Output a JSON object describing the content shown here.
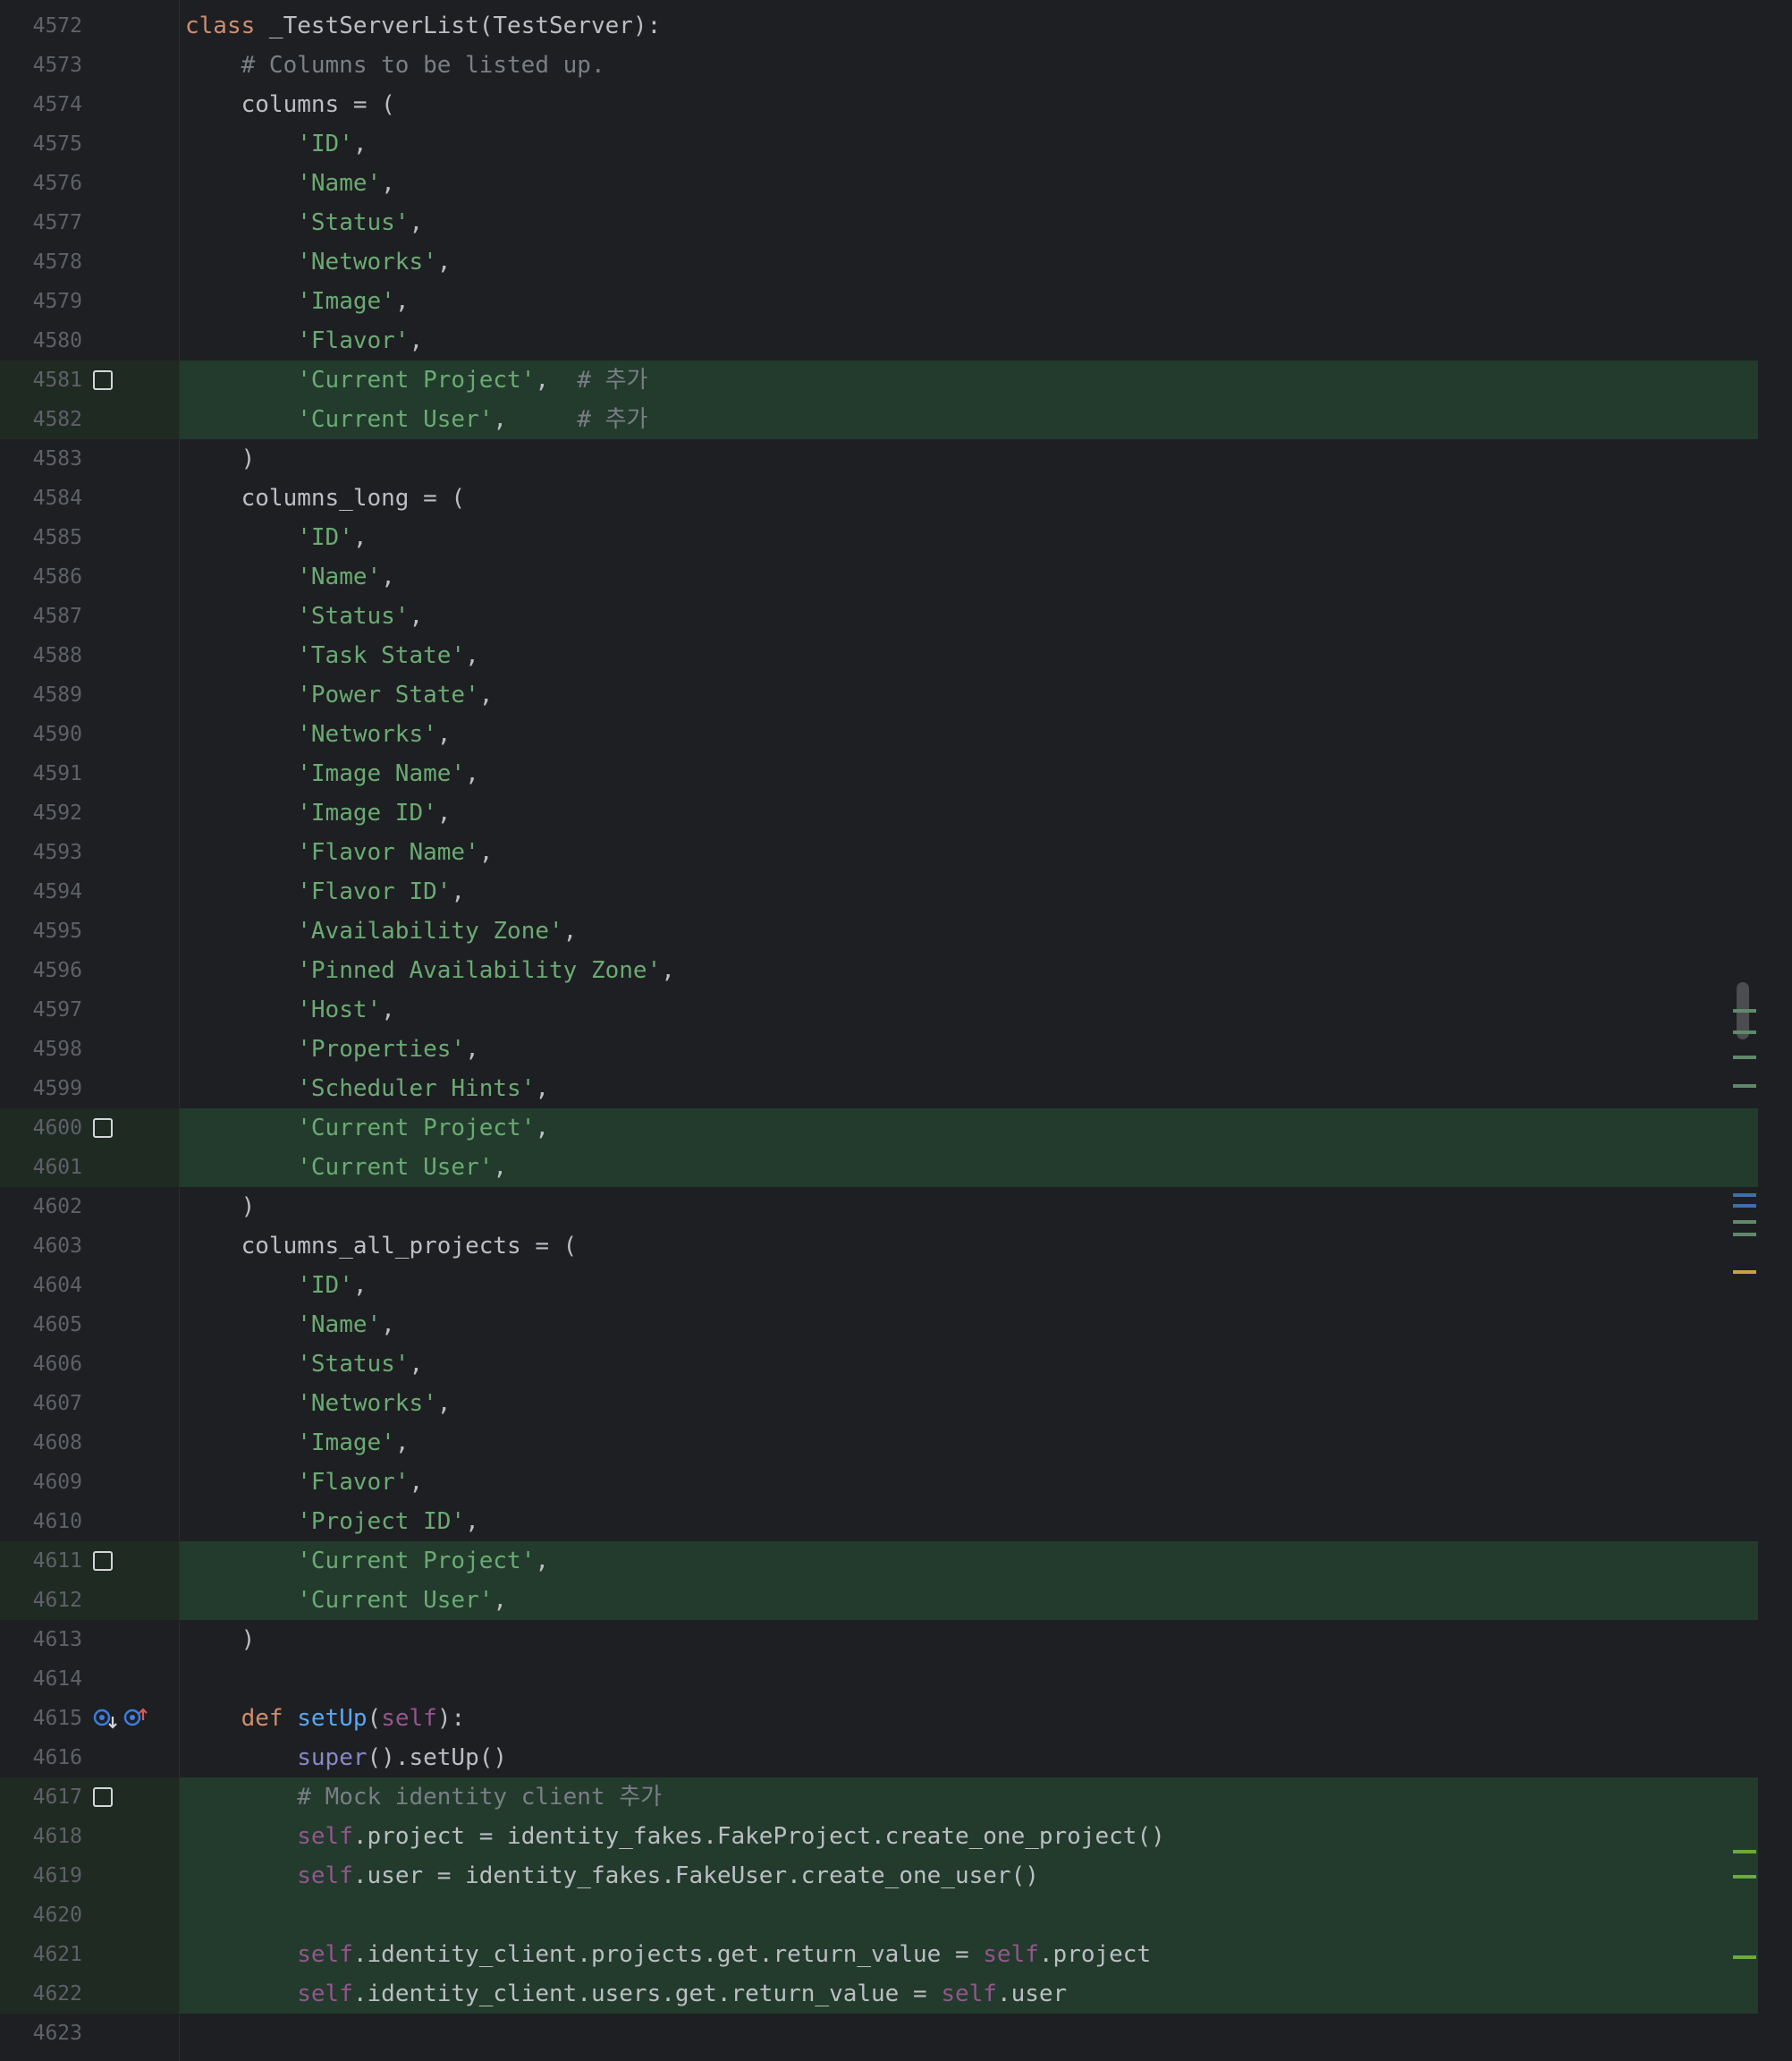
{
  "editor": {
    "language": "python",
    "colors": {
      "background": "#1e1f22",
      "added_line_bg": "#223b2c",
      "line_number": "#5e6168",
      "keyword": "#cf8e6d",
      "string": "#6aab73",
      "comment": "#7a7e85",
      "function": "#56a8f5",
      "self": "#94558d",
      "builtin": "#8888c6",
      "text": "#bcbec4"
    },
    "gutter_icons": [
      "implemented-by-down-icon",
      "overrides-up-icon"
    ],
    "lines": [
      {
        "n": "4572",
        "added": false,
        "checkbox": false,
        "tokens": [
          {
            "t": "kw",
            "v": "class"
          },
          {
            "t": "id",
            "v": " _TestServerList(TestServer):"
          }
        ]
      },
      {
        "n": "4573",
        "added": false,
        "checkbox": false,
        "tokens": [
          {
            "t": "cm",
            "v": "    # Columns to be listed up."
          }
        ]
      },
      {
        "n": "4574",
        "added": false,
        "checkbox": false,
        "tokens": [
          {
            "t": "id",
            "v": "    columns = ("
          }
        ]
      },
      {
        "n": "4575",
        "added": false,
        "checkbox": false,
        "tokens": [
          {
            "t": "id",
            "v": "        "
          },
          {
            "t": "str",
            "v": "'ID'"
          },
          {
            "t": "id",
            "v": ","
          }
        ]
      },
      {
        "n": "4576",
        "added": false,
        "checkbox": false,
        "tokens": [
          {
            "t": "id",
            "v": "        "
          },
          {
            "t": "str",
            "v": "'Name'"
          },
          {
            "t": "id",
            "v": ","
          }
        ]
      },
      {
        "n": "4577",
        "added": false,
        "checkbox": false,
        "tokens": [
          {
            "t": "id",
            "v": "        "
          },
          {
            "t": "str",
            "v": "'Status'"
          },
          {
            "t": "id",
            "v": ","
          }
        ]
      },
      {
        "n": "4578",
        "added": false,
        "checkbox": false,
        "tokens": [
          {
            "t": "id",
            "v": "        "
          },
          {
            "t": "str",
            "v": "'Networks'"
          },
          {
            "t": "id",
            "v": ","
          }
        ]
      },
      {
        "n": "4579",
        "added": false,
        "checkbox": false,
        "tokens": [
          {
            "t": "id",
            "v": "        "
          },
          {
            "t": "str",
            "v": "'Image'"
          },
          {
            "t": "id",
            "v": ","
          }
        ]
      },
      {
        "n": "4580",
        "added": false,
        "checkbox": false,
        "tokens": [
          {
            "t": "id",
            "v": "        "
          },
          {
            "t": "str",
            "v": "'Flavor'"
          },
          {
            "t": "id",
            "v": ","
          }
        ]
      },
      {
        "n": "4581",
        "added": true,
        "checkbox": true,
        "tokens": [
          {
            "t": "id",
            "v": "        "
          },
          {
            "t": "str",
            "v": "'Current Project'"
          },
          {
            "t": "id",
            "v": ",  "
          },
          {
            "t": "cm",
            "v": "# 추가"
          }
        ]
      },
      {
        "n": "4582",
        "added": true,
        "checkbox": false,
        "tokens": [
          {
            "t": "id",
            "v": "        "
          },
          {
            "t": "str",
            "v": "'Current User'"
          },
          {
            "t": "id",
            "v": ",     "
          },
          {
            "t": "cm",
            "v": "# 추가"
          }
        ]
      },
      {
        "n": "4583",
        "added": false,
        "checkbox": false,
        "tokens": [
          {
            "t": "id",
            "v": "    )"
          }
        ]
      },
      {
        "n": "4584",
        "added": false,
        "checkbox": false,
        "tokens": [
          {
            "t": "id",
            "v": "    columns_long = ("
          }
        ]
      },
      {
        "n": "4585",
        "added": false,
        "checkbox": false,
        "tokens": [
          {
            "t": "id",
            "v": "        "
          },
          {
            "t": "str",
            "v": "'ID'"
          },
          {
            "t": "id",
            "v": ","
          }
        ]
      },
      {
        "n": "4586",
        "added": false,
        "checkbox": false,
        "tokens": [
          {
            "t": "id",
            "v": "        "
          },
          {
            "t": "str",
            "v": "'Name'"
          },
          {
            "t": "id",
            "v": ","
          }
        ]
      },
      {
        "n": "4587",
        "added": false,
        "checkbox": false,
        "tokens": [
          {
            "t": "id",
            "v": "        "
          },
          {
            "t": "str",
            "v": "'Status'"
          },
          {
            "t": "id",
            "v": ","
          }
        ]
      },
      {
        "n": "4588",
        "added": false,
        "checkbox": false,
        "tokens": [
          {
            "t": "id",
            "v": "        "
          },
          {
            "t": "str",
            "v": "'Task State'"
          },
          {
            "t": "id",
            "v": ","
          }
        ]
      },
      {
        "n": "4589",
        "added": false,
        "checkbox": false,
        "tokens": [
          {
            "t": "id",
            "v": "        "
          },
          {
            "t": "str",
            "v": "'Power State'"
          },
          {
            "t": "id",
            "v": ","
          }
        ]
      },
      {
        "n": "4590",
        "added": false,
        "checkbox": false,
        "tokens": [
          {
            "t": "id",
            "v": "        "
          },
          {
            "t": "str",
            "v": "'Networks'"
          },
          {
            "t": "id",
            "v": ","
          }
        ]
      },
      {
        "n": "4591",
        "added": false,
        "checkbox": false,
        "tokens": [
          {
            "t": "id",
            "v": "        "
          },
          {
            "t": "str",
            "v": "'Image Name'"
          },
          {
            "t": "id",
            "v": ","
          }
        ]
      },
      {
        "n": "4592",
        "added": false,
        "checkbox": false,
        "tokens": [
          {
            "t": "id",
            "v": "        "
          },
          {
            "t": "str",
            "v": "'Image ID'"
          },
          {
            "t": "id",
            "v": ","
          }
        ]
      },
      {
        "n": "4593",
        "added": false,
        "checkbox": false,
        "tokens": [
          {
            "t": "id",
            "v": "        "
          },
          {
            "t": "str",
            "v": "'Flavor Name'"
          },
          {
            "t": "id",
            "v": ","
          }
        ]
      },
      {
        "n": "4594",
        "added": false,
        "checkbox": false,
        "tokens": [
          {
            "t": "id",
            "v": "        "
          },
          {
            "t": "str",
            "v": "'Flavor ID'"
          },
          {
            "t": "id",
            "v": ","
          }
        ]
      },
      {
        "n": "4595",
        "added": false,
        "checkbox": false,
        "tokens": [
          {
            "t": "id",
            "v": "        "
          },
          {
            "t": "str",
            "v": "'Availability Zone'"
          },
          {
            "t": "id",
            "v": ","
          }
        ]
      },
      {
        "n": "4596",
        "added": false,
        "checkbox": false,
        "tokens": [
          {
            "t": "id",
            "v": "        "
          },
          {
            "t": "str",
            "v": "'Pinned Availability Zone'"
          },
          {
            "t": "id",
            "v": ","
          }
        ]
      },
      {
        "n": "4597",
        "added": false,
        "checkbox": false,
        "tokens": [
          {
            "t": "id",
            "v": "        "
          },
          {
            "t": "str",
            "v": "'Host'"
          },
          {
            "t": "id",
            "v": ","
          }
        ]
      },
      {
        "n": "4598",
        "added": false,
        "checkbox": false,
        "tokens": [
          {
            "t": "id",
            "v": "        "
          },
          {
            "t": "str",
            "v": "'Properties'"
          },
          {
            "t": "id",
            "v": ","
          }
        ]
      },
      {
        "n": "4599",
        "added": false,
        "checkbox": false,
        "tokens": [
          {
            "t": "id",
            "v": "        "
          },
          {
            "t": "str",
            "v": "'Scheduler Hints'"
          },
          {
            "t": "id",
            "v": ","
          }
        ]
      },
      {
        "n": "4600",
        "added": true,
        "checkbox": true,
        "tokens": [
          {
            "t": "id",
            "v": "        "
          },
          {
            "t": "str",
            "v": "'Current Project'"
          },
          {
            "t": "id",
            "v": ","
          }
        ]
      },
      {
        "n": "4601",
        "added": true,
        "checkbox": false,
        "tokens": [
          {
            "t": "id",
            "v": "        "
          },
          {
            "t": "str",
            "v": "'Current User'"
          },
          {
            "t": "id",
            "v": ","
          }
        ]
      },
      {
        "n": "4602",
        "added": false,
        "checkbox": false,
        "tokens": [
          {
            "t": "id",
            "v": "    )"
          }
        ]
      },
      {
        "n": "4603",
        "added": false,
        "checkbox": false,
        "tokens": [
          {
            "t": "id",
            "v": "    columns_all_projects = ("
          }
        ]
      },
      {
        "n": "4604",
        "added": false,
        "checkbox": false,
        "tokens": [
          {
            "t": "id",
            "v": "        "
          },
          {
            "t": "str",
            "v": "'ID'"
          },
          {
            "t": "id",
            "v": ","
          }
        ]
      },
      {
        "n": "4605",
        "added": false,
        "checkbox": false,
        "tokens": [
          {
            "t": "id",
            "v": "        "
          },
          {
            "t": "str",
            "v": "'Name'"
          },
          {
            "t": "id",
            "v": ","
          }
        ]
      },
      {
        "n": "4606",
        "added": false,
        "checkbox": false,
        "tokens": [
          {
            "t": "id",
            "v": "        "
          },
          {
            "t": "str",
            "v": "'Status'"
          },
          {
            "t": "id",
            "v": ","
          }
        ]
      },
      {
        "n": "4607",
        "added": false,
        "checkbox": false,
        "tokens": [
          {
            "t": "id",
            "v": "        "
          },
          {
            "t": "str",
            "v": "'Networks'"
          },
          {
            "t": "id",
            "v": ","
          }
        ]
      },
      {
        "n": "4608",
        "added": false,
        "checkbox": false,
        "tokens": [
          {
            "t": "id",
            "v": "        "
          },
          {
            "t": "str",
            "v": "'Image'"
          },
          {
            "t": "id",
            "v": ","
          }
        ]
      },
      {
        "n": "4609",
        "added": false,
        "checkbox": false,
        "tokens": [
          {
            "t": "id",
            "v": "        "
          },
          {
            "t": "str",
            "v": "'Flavor'"
          },
          {
            "t": "id",
            "v": ","
          }
        ]
      },
      {
        "n": "4610",
        "added": false,
        "checkbox": false,
        "tokens": [
          {
            "t": "id",
            "v": "        "
          },
          {
            "t": "str",
            "v": "'Project ID'"
          },
          {
            "t": "id",
            "v": ","
          }
        ]
      },
      {
        "n": "4611",
        "added": true,
        "checkbox": true,
        "tokens": [
          {
            "t": "id",
            "v": "        "
          },
          {
            "t": "str",
            "v": "'Current Project'"
          },
          {
            "t": "id",
            "v": ","
          }
        ]
      },
      {
        "n": "4612",
        "added": true,
        "checkbox": false,
        "tokens": [
          {
            "t": "id",
            "v": "        "
          },
          {
            "t": "str",
            "v": "'Current User'"
          },
          {
            "t": "id",
            "v": ","
          }
        ]
      },
      {
        "n": "4613",
        "added": false,
        "checkbox": false,
        "tokens": [
          {
            "t": "id",
            "v": "    )"
          }
        ]
      },
      {
        "n": "4614",
        "added": false,
        "checkbox": false,
        "tokens": []
      },
      {
        "n": "4615",
        "added": false,
        "checkbox": false,
        "icons": true,
        "tokens": [
          {
            "t": "id",
            "v": "    "
          },
          {
            "t": "kw",
            "v": "def"
          },
          {
            "t": "id",
            "v": " "
          },
          {
            "t": "fn",
            "v": "setUp"
          },
          {
            "t": "id",
            "v": "("
          },
          {
            "t": "self",
            "v": "self"
          },
          {
            "t": "id",
            "v": "):"
          }
        ]
      },
      {
        "n": "4616",
        "added": false,
        "checkbox": false,
        "tokens": [
          {
            "t": "id",
            "v": "        "
          },
          {
            "t": "bi",
            "v": "super"
          },
          {
            "t": "id",
            "v": "().setUp()"
          }
        ]
      },
      {
        "n": "4617",
        "added": true,
        "checkbox": true,
        "tokens": [
          {
            "t": "id",
            "v": "        "
          },
          {
            "t": "cm",
            "v": "# Mock identity client 추가"
          }
        ]
      },
      {
        "n": "4618",
        "added": true,
        "checkbox": false,
        "tokens": [
          {
            "t": "id",
            "v": "        "
          },
          {
            "t": "self",
            "v": "self"
          },
          {
            "t": "id",
            "v": ".project = identity_fakes.FakeProject.create_one_project()"
          }
        ]
      },
      {
        "n": "4619",
        "added": true,
        "checkbox": false,
        "tokens": [
          {
            "t": "id",
            "v": "        "
          },
          {
            "t": "self",
            "v": "self"
          },
          {
            "t": "id",
            "v": ".user = identity_fakes.FakeUser.create_one_user()"
          }
        ]
      },
      {
        "n": "4620",
        "added": true,
        "checkbox": false,
        "tokens": []
      },
      {
        "n": "4621",
        "added": true,
        "checkbox": false,
        "tokens": [
          {
            "t": "id",
            "v": "        "
          },
          {
            "t": "self",
            "v": "self"
          },
          {
            "t": "id",
            "v": ".identity_client.projects.get.return_value = "
          },
          {
            "t": "self",
            "v": "self"
          },
          {
            "t": "id",
            "v": ".project"
          }
        ]
      },
      {
        "n": "4622",
        "added": true,
        "checkbox": false,
        "tokens": [
          {
            "t": "id",
            "v": "        "
          },
          {
            "t": "self",
            "v": "self"
          },
          {
            "t": "id",
            "v": ".identity_client.users.get.return_value = "
          },
          {
            "t": "self",
            "v": "self"
          },
          {
            "t": "id",
            "v": ".user"
          }
        ]
      },
      {
        "n": "4623",
        "added": false,
        "checkbox": false,
        "tokens": []
      }
    ],
    "scroll_marks": [
      {
        "color": "#5f8a6a"
      },
      {
        "color": "#5f8a6a"
      },
      {
        "color": "#5f8a6a"
      },
      {
        "color": "#5f8a6a"
      },
      {
        "color": "#3d6fae"
      },
      {
        "color": "#3d6fae"
      },
      {
        "color": "#5f8a6a"
      },
      {
        "color": "#5f8a6a"
      },
      {
        "color": "#c9a144"
      },
      {
        "color": "#6aab3a"
      },
      {
        "color": "#6aab3a"
      },
      {
        "color": "#6aab3a"
      }
    ]
  }
}
